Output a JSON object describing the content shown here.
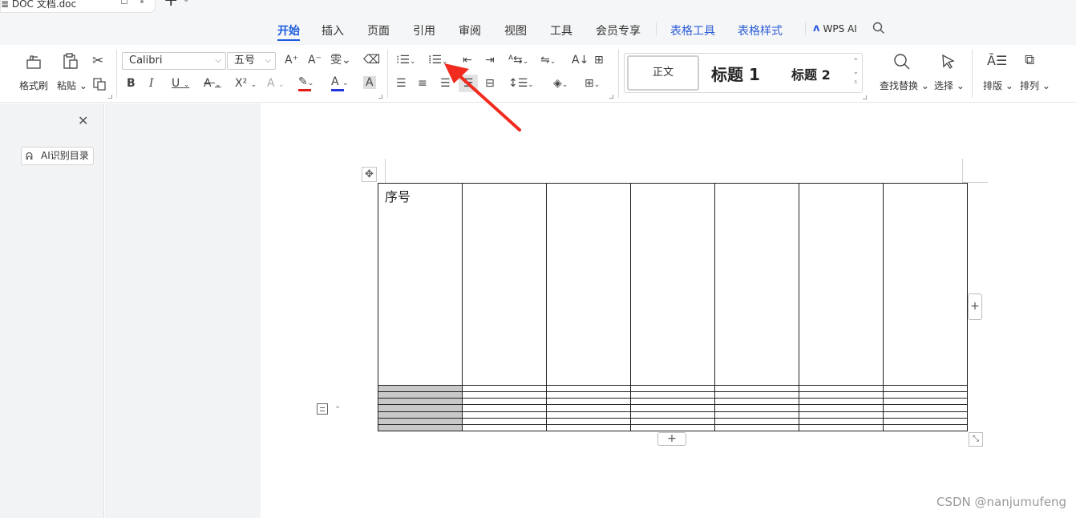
{
  "window": {
    "doc_tab_title": "≣ DOC 文档.doc",
    "new_tab_label": "+"
  },
  "menu": {
    "items": [
      {
        "label": "开始",
        "active": true
      },
      {
        "label": "插入"
      },
      {
        "label": "页面"
      },
      {
        "label": "引用"
      },
      {
        "label": "审阅"
      },
      {
        "label": "视图"
      },
      {
        "label": "工具"
      },
      {
        "label": "会员专享"
      },
      {
        "label": "表格工具",
        "context": true
      },
      {
        "label": "表格样式",
        "context": true
      }
    ],
    "wps_ai_label": "WPS AI"
  },
  "ribbon": {
    "format_painter": "格式刷",
    "paste": "粘贴",
    "font_name": "Calibri",
    "font_size": "五号",
    "bold": "B",
    "italic": "I",
    "underline": "U",
    "strike": "A",
    "superscript": "X²",
    "font_color_letter": "A",
    "char_shade_letter": "A",
    "styles": {
      "normal": "正文",
      "heading1": "标题 1",
      "heading2": "标题 2"
    },
    "find_replace": "查找替换",
    "select": "选择",
    "layout": "排版",
    "arrange": "排列"
  },
  "sidebar": {
    "ai_toc_button": "AI识别目录"
  },
  "table": {
    "header_cell": "序号",
    "rows": 8,
    "cols": 7
  },
  "watermark": "CSDN @nanjumufeng",
  "colors": {
    "accent": "#1b5be0",
    "context_tab": "#2a5bd7",
    "font_color_bar": "#e0201b",
    "font_color_blue": "#2436d9",
    "arrow": "#f22b1f",
    "shaded_cell": "#c8c8c8"
  }
}
